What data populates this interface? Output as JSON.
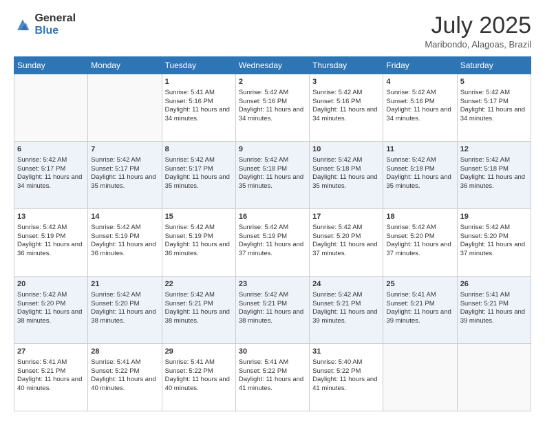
{
  "header": {
    "logo_general": "General",
    "logo_blue": "Blue",
    "month_title": "July 2025",
    "location": "Maribondo, Alagoas, Brazil"
  },
  "weekdays": [
    "Sunday",
    "Monday",
    "Tuesday",
    "Wednesday",
    "Thursday",
    "Friday",
    "Saturday"
  ],
  "weeks": [
    [
      {
        "day": "",
        "info": ""
      },
      {
        "day": "",
        "info": ""
      },
      {
        "day": "1",
        "info": "Sunrise: 5:41 AM\nSunset: 5:16 PM\nDaylight: 11 hours and 34 minutes."
      },
      {
        "day": "2",
        "info": "Sunrise: 5:42 AM\nSunset: 5:16 PM\nDaylight: 11 hours and 34 minutes."
      },
      {
        "day": "3",
        "info": "Sunrise: 5:42 AM\nSunset: 5:16 PM\nDaylight: 11 hours and 34 minutes."
      },
      {
        "day": "4",
        "info": "Sunrise: 5:42 AM\nSunset: 5:16 PM\nDaylight: 11 hours and 34 minutes."
      },
      {
        "day": "5",
        "info": "Sunrise: 5:42 AM\nSunset: 5:17 PM\nDaylight: 11 hours and 34 minutes."
      }
    ],
    [
      {
        "day": "6",
        "info": "Sunrise: 5:42 AM\nSunset: 5:17 PM\nDaylight: 11 hours and 34 minutes."
      },
      {
        "day": "7",
        "info": "Sunrise: 5:42 AM\nSunset: 5:17 PM\nDaylight: 11 hours and 35 minutes."
      },
      {
        "day": "8",
        "info": "Sunrise: 5:42 AM\nSunset: 5:17 PM\nDaylight: 11 hours and 35 minutes."
      },
      {
        "day": "9",
        "info": "Sunrise: 5:42 AM\nSunset: 5:18 PM\nDaylight: 11 hours and 35 minutes."
      },
      {
        "day": "10",
        "info": "Sunrise: 5:42 AM\nSunset: 5:18 PM\nDaylight: 11 hours and 35 minutes."
      },
      {
        "day": "11",
        "info": "Sunrise: 5:42 AM\nSunset: 5:18 PM\nDaylight: 11 hours and 35 minutes."
      },
      {
        "day": "12",
        "info": "Sunrise: 5:42 AM\nSunset: 5:18 PM\nDaylight: 11 hours and 36 minutes."
      }
    ],
    [
      {
        "day": "13",
        "info": "Sunrise: 5:42 AM\nSunset: 5:19 PM\nDaylight: 11 hours and 36 minutes."
      },
      {
        "day": "14",
        "info": "Sunrise: 5:42 AM\nSunset: 5:19 PM\nDaylight: 11 hours and 36 minutes."
      },
      {
        "day": "15",
        "info": "Sunrise: 5:42 AM\nSunset: 5:19 PM\nDaylight: 11 hours and 36 minutes."
      },
      {
        "day": "16",
        "info": "Sunrise: 5:42 AM\nSunset: 5:19 PM\nDaylight: 11 hours and 37 minutes."
      },
      {
        "day": "17",
        "info": "Sunrise: 5:42 AM\nSunset: 5:20 PM\nDaylight: 11 hours and 37 minutes."
      },
      {
        "day": "18",
        "info": "Sunrise: 5:42 AM\nSunset: 5:20 PM\nDaylight: 11 hours and 37 minutes."
      },
      {
        "day": "19",
        "info": "Sunrise: 5:42 AM\nSunset: 5:20 PM\nDaylight: 11 hours and 37 minutes."
      }
    ],
    [
      {
        "day": "20",
        "info": "Sunrise: 5:42 AM\nSunset: 5:20 PM\nDaylight: 11 hours and 38 minutes."
      },
      {
        "day": "21",
        "info": "Sunrise: 5:42 AM\nSunset: 5:20 PM\nDaylight: 11 hours and 38 minutes."
      },
      {
        "day": "22",
        "info": "Sunrise: 5:42 AM\nSunset: 5:21 PM\nDaylight: 11 hours and 38 minutes."
      },
      {
        "day": "23",
        "info": "Sunrise: 5:42 AM\nSunset: 5:21 PM\nDaylight: 11 hours and 38 minutes."
      },
      {
        "day": "24",
        "info": "Sunrise: 5:42 AM\nSunset: 5:21 PM\nDaylight: 11 hours and 39 minutes."
      },
      {
        "day": "25",
        "info": "Sunrise: 5:41 AM\nSunset: 5:21 PM\nDaylight: 11 hours and 39 minutes."
      },
      {
        "day": "26",
        "info": "Sunrise: 5:41 AM\nSunset: 5:21 PM\nDaylight: 11 hours and 39 minutes."
      }
    ],
    [
      {
        "day": "27",
        "info": "Sunrise: 5:41 AM\nSunset: 5:21 PM\nDaylight: 11 hours and 40 minutes."
      },
      {
        "day": "28",
        "info": "Sunrise: 5:41 AM\nSunset: 5:22 PM\nDaylight: 11 hours and 40 minutes."
      },
      {
        "day": "29",
        "info": "Sunrise: 5:41 AM\nSunset: 5:22 PM\nDaylight: 11 hours and 40 minutes."
      },
      {
        "day": "30",
        "info": "Sunrise: 5:41 AM\nSunset: 5:22 PM\nDaylight: 11 hours and 41 minutes."
      },
      {
        "day": "31",
        "info": "Sunrise: 5:40 AM\nSunset: 5:22 PM\nDaylight: 11 hours and 41 minutes."
      },
      {
        "day": "",
        "info": ""
      },
      {
        "day": "",
        "info": ""
      }
    ]
  ]
}
